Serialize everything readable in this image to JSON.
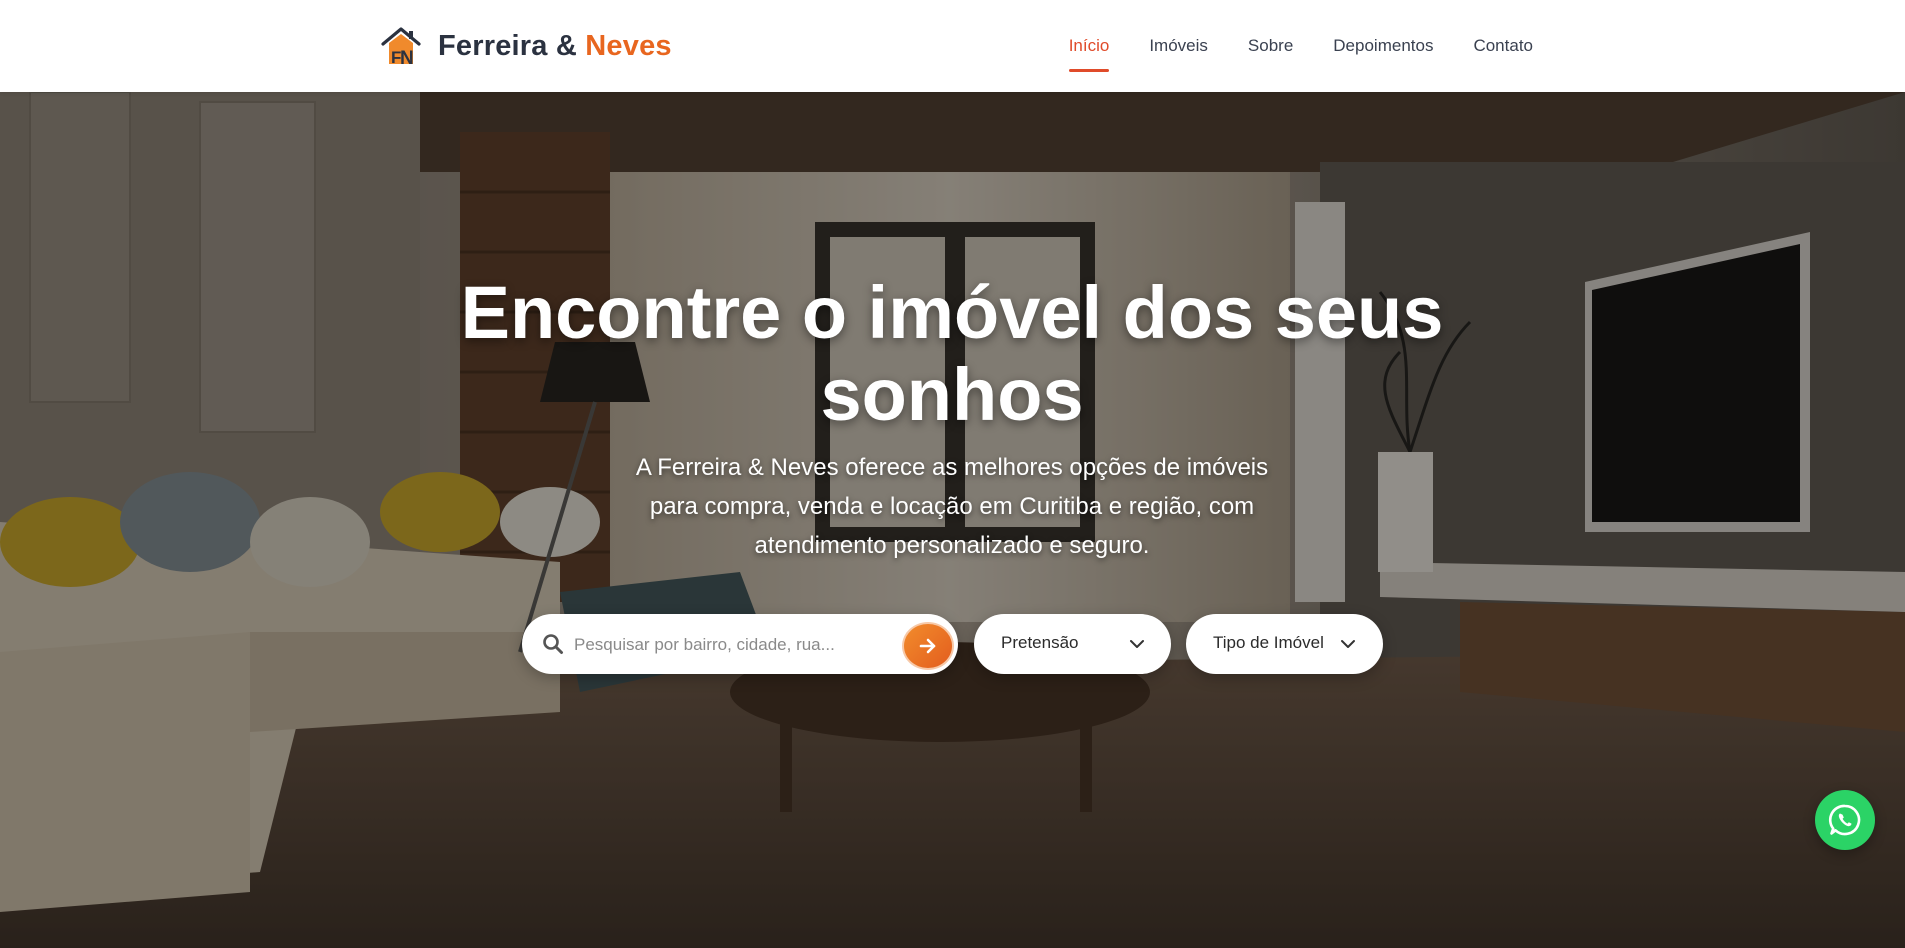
{
  "brand": {
    "name_part1": "Ferreira &",
    "name_part2": "Neves",
    "logo_icon": "house-fn-logo-icon",
    "accent_color": "#e8661f"
  },
  "nav": {
    "items": [
      {
        "label": "Início",
        "active": true
      },
      {
        "label": "Imóveis",
        "active": false
      },
      {
        "label": "Sobre",
        "active": false
      },
      {
        "label": "Depoimentos",
        "active": false
      },
      {
        "label": "Contato",
        "active": false
      }
    ],
    "active_color": "#e04b2a"
  },
  "hero": {
    "title": "Encontre o imóvel dos seus sonhos",
    "subtitle": "A Ferreira & Neves oferece as melhores opções de imóveis para compra, venda e locação em Curitiba e região, com atendimento personalizado e seguro.",
    "background": "living-room-photo"
  },
  "search": {
    "placeholder": "Pesquisar por bairro, cidade, rua...",
    "value": "",
    "search_icon": "search-icon",
    "submit_icon": "arrow-right-icon"
  },
  "filters": {
    "pretensao": {
      "label": "Pretensão",
      "icon": "chevron-down-icon"
    },
    "tipo_imovel": {
      "label": "Tipo de Imóvel",
      "icon": "chevron-down-icon"
    }
  },
  "whatsapp": {
    "icon": "whatsapp-icon",
    "color": "#2bd366"
  }
}
